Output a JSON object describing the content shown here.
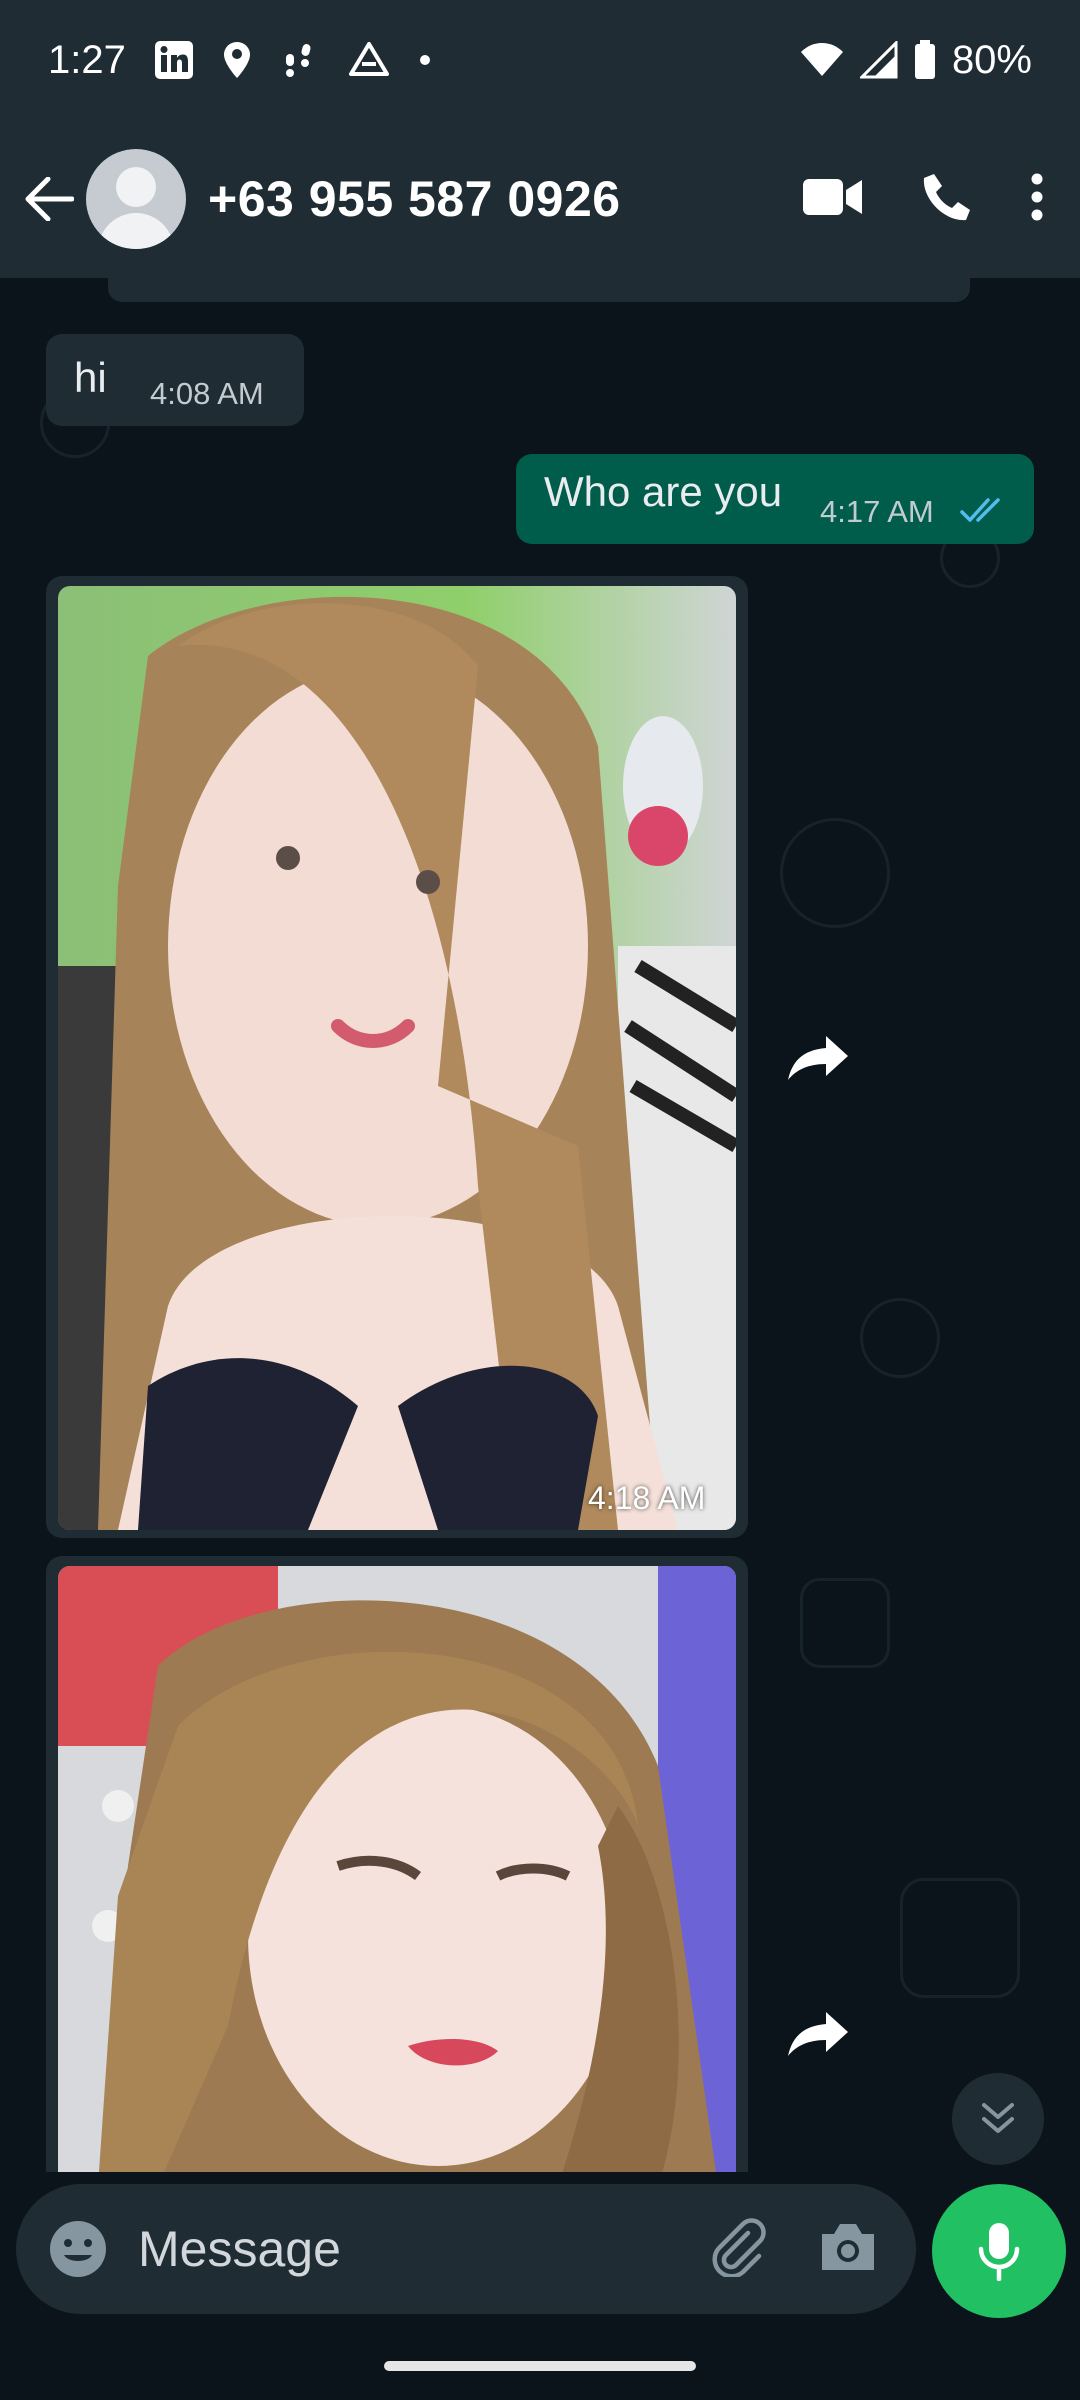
{
  "status_bar": {
    "time": "1:27",
    "battery": "80%",
    "left_icons": [
      "linkedin-icon",
      "location-icon",
      "walking-icon",
      "drive-icon",
      "dot-icon"
    ],
    "right_icons": [
      "wifi-icon",
      "signal-icon",
      "battery-icon"
    ]
  },
  "header": {
    "contact_name": "+63 955 587 0926",
    "actions": [
      "video-call-icon",
      "voice-call-icon",
      "more-options-icon"
    ]
  },
  "messages": [
    {
      "direction": "in",
      "type": "text",
      "text": "hi",
      "time": "4:08 AM"
    },
    {
      "direction": "out",
      "type": "text",
      "text": "Who are you",
      "time": "4:17 AM",
      "status": "read"
    },
    {
      "direction": "in",
      "type": "image",
      "time": "4:18 AM"
    },
    {
      "direction": "in",
      "type": "image",
      "time": ""
    }
  ],
  "composer": {
    "placeholder": "Message"
  },
  "colors": {
    "header_bg": "#1f2c34",
    "chat_bg": "#0b141a",
    "incoming_bubble": "#1f2c34",
    "outgoing_bubble": "#005c4b",
    "accent_green": "#21c063",
    "read_tick": "#53bdeb"
  }
}
